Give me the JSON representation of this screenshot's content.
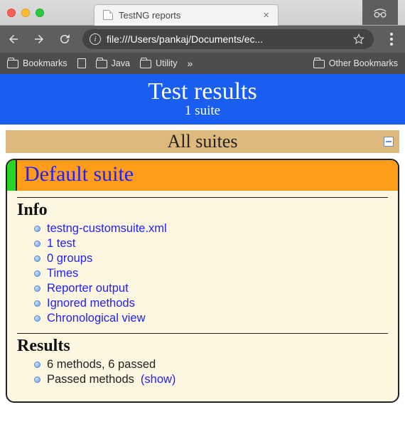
{
  "browser": {
    "tab_title": "TestNG reports",
    "url": "file:///Users/pankaj/Documents/ec...",
    "bookmarks_label": "Bookmarks",
    "bm_java": "Java",
    "bm_utility": "Utility",
    "bm_other": "Other Bookmarks"
  },
  "header": {
    "title": "Test results",
    "subtitle": "1 suite"
  },
  "all_suites_label": "All suites",
  "suite": {
    "name": "Default suite",
    "info_heading": "Info",
    "results_heading": "Results",
    "info_items": {
      "i0": "testng-customsuite.xml",
      "i1": "1 test",
      "i2": "0 groups",
      "i3": "Times",
      "i4": "Reporter output",
      "i5": "Ignored methods",
      "i6": "Chronological view"
    },
    "results_items": {
      "r0": "6 methods, 6 passed",
      "r1_prefix": "Passed methods ",
      "r1_show": "(show)"
    }
  }
}
